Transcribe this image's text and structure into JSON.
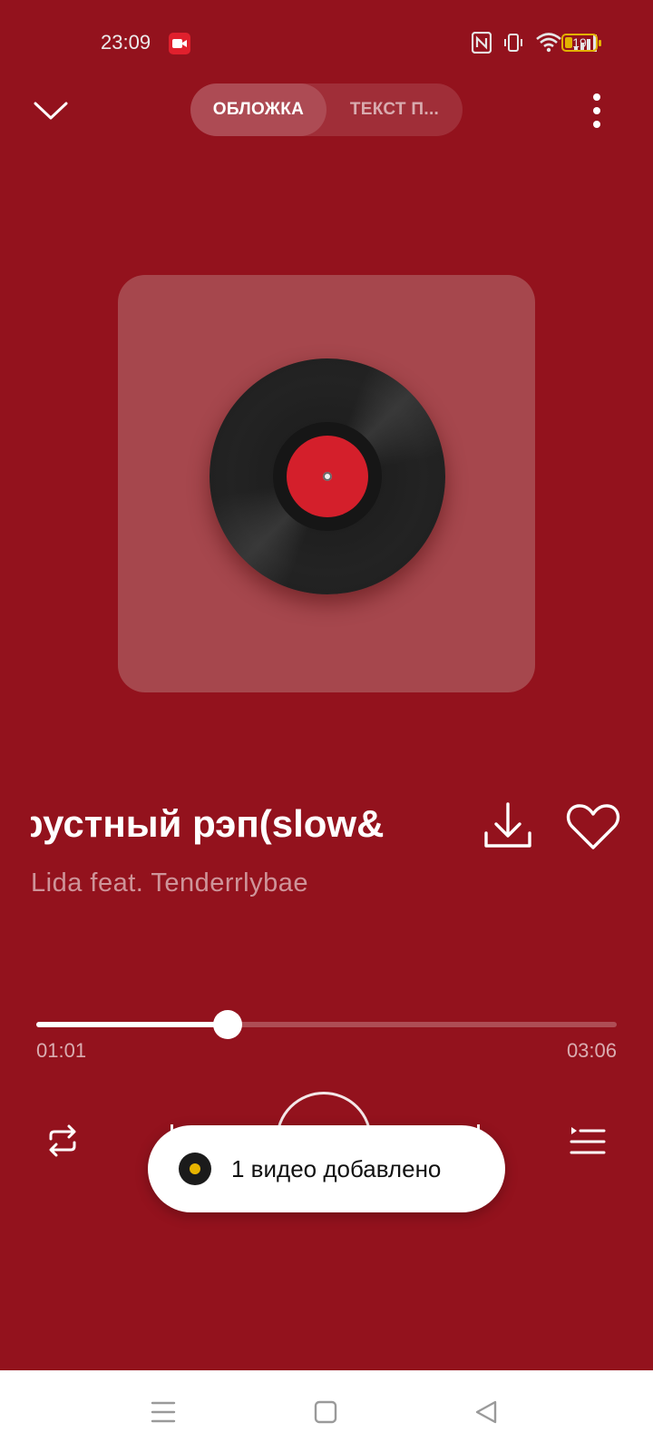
{
  "status_bar": {
    "time": "23:09",
    "battery_level": "19",
    "icons": [
      "screen-record-icon",
      "nfc-icon",
      "vibrate-icon",
      "wifi-icon",
      "cell-signal-icon",
      "battery-icon"
    ]
  },
  "header": {
    "tabs": [
      {
        "label": "ОБЛОЖКА",
        "active": true
      },
      {
        "label": "ТЕКСТ П...",
        "active": false
      }
    ]
  },
  "track": {
    "title": "рустный рэп(slow&",
    "artist": "Lida feat. Tenderrlybae"
  },
  "progress": {
    "current": "01:01",
    "total": "03:06",
    "fraction": 0.33
  },
  "toast": {
    "text": "1 видео добавлено"
  },
  "colors": {
    "background": "#93121d",
    "cover": "#a6474d",
    "record_label": "#d41f2b",
    "toast_icon_dot": "#e7b400"
  }
}
